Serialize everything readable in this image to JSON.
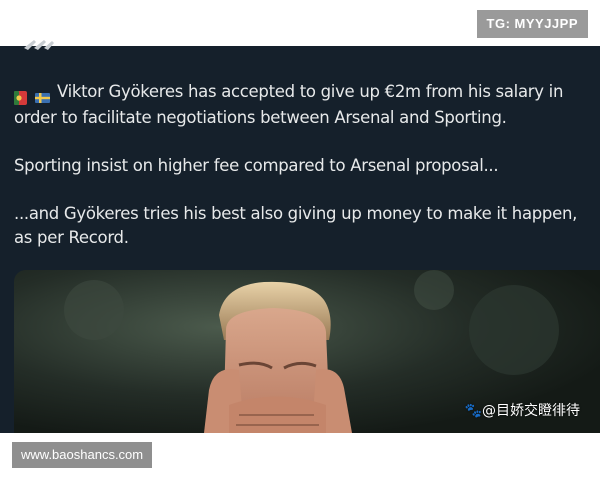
{
  "tweet": {
    "paragraphs": [
      "Viktor Gyökeres has accepted to give up €2m from his salary in order to facilitate negotiations between Arsenal and Sporting.",
      "Sporting insist on higher fee compared to Arsenal proposal...",
      "...and Gyökeres tries his best also giving up money to make it happen, as per Record."
    ],
    "flag_icons": [
      "portugal-flag-icon",
      "sweden-flag-icon"
    ]
  },
  "watermarks": {
    "top_right": "TG: MYYJJPP",
    "bottom_left": "www.baoshancs.com",
    "overlay_cn": "@目娇交瞪徘待"
  },
  "colors": {
    "tweet_background": "#15202b",
    "tweet_text": "#e7e9ea",
    "watermark_box": "#9a9a9a"
  }
}
